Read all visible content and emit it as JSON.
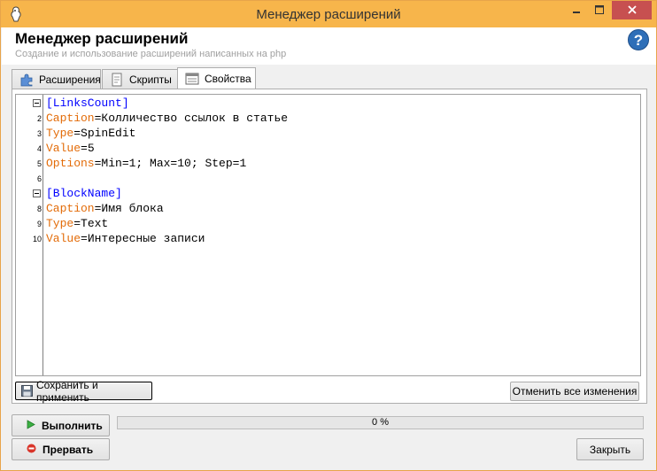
{
  "window": {
    "title": "Менеджер расширений",
    "minimize_icon": "minimize-icon",
    "maximize_icon": "maximize-icon",
    "close_icon": "close-icon",
    "accent_color": "#f7b54b"
  },
  "header": {
    "title": "Менеджер расширений",
    "subtitle": "Создание и использование расширений написанных на php",
    "help_label": "?"
  },
  "tabs": [
    {
      "label": "Расширения",
      "icon": "puzzle-icon",
      "active": false
    },
    {
      "label": "Скрипты",
      "icon": "document-icon",
      "active": false
    },
    {
      "label": "Свойства",
      "icon": "properties-icon",
      "active": true
    }
  ],
  "editor": {
    "lines": [
      {
        "num": "1",
        "fold": true,
        "section": "[LinksCount]"
      },
      {
        "num": "2",
        "key": "Caption",
        "value": "Колличество ссылок в статье"
      },
      {
        "num": "3",
        "key": "Type",
        "value": "SpinEdit"
      },
      {
        "num": "4",
        "key": "Value",
        "value": "5"
      },
      {
        "num": "5",
        "key": "Options",
        "value": "Min=1; Max=10; Step=1"
      },
      {
        "num": "6"
      },
      {
        "num": "7",
        "fold": true,
        "section": "[BlockName]"
      },
      {
        "num": "8",
        "key": "Caption",
        "value": "Имя блока"
      },
      {
        "num": "9",
        "key": "Type",
        "value": "Text"
      },
      {
        "num": "10",
        "key": "Value",
        "value": "Интересные записи"
      }
    ]
  },
  "panel_buttons": {
    "save_label": "Сохранить и применить",
    "revert_label": "Отменить все изменения"
  },
  "footer": {
    "run_label": "Выполнить",
    "stop_label": "Прервать",
    "close_label": "Закрыть",
    "progress_text": "0 %",
    "progress_value": 0
  }
}
